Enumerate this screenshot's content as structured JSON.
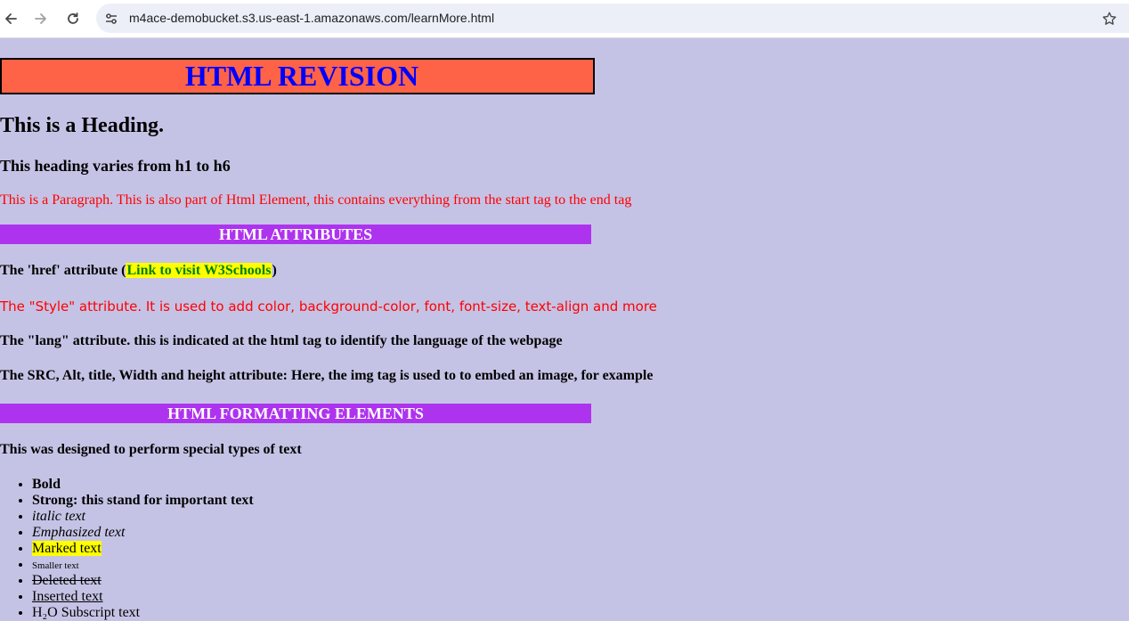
{
  "browser": {
    "url": "m4ace-demobucket.s3.us-east-1.amazonaws.com/learnMore.html",
    "icons": [
      "back-arrow-icon",
      "forward-arrow-icon",
      "reload-icon",
      "site-info-icon",
      "bookmark-star-icon"
    ]
  },
  "page": {
    "title": "HTML REVISION",
    "heading": "This is a Heading.",
    "subheading": "This heading varies from h1 to h6",
    "paragraph": "This is a Paragraph. This is also part of Html Element, this contains everything from the start tag to the end tag",
    "attributes_banner": "HTML ATTRIBUTES",
    "href": {
      "prefix": "The 'href' attribute (",
      "link": "Link to visit W3Schools",
      "suffix": ")"
    },
    "style_line": "The \"Style\" attribute. It is used to add color, background-color, font, font-size, text-align and more",
    "lang_line": "The \"lang\" attribute. this is indicated at the html tag to identify the language of the webpage",
    "src_line": "The SRC, Alt, title, Width and height attribute: Here, the img tag is used to to embed an image, for example",
    "formatting_banner": "HTML FORMATTING ELEMENTS",
    "formatting_intro": "This was designed to perform special types of text",
    "formatting_items": {
      "bold": "Bold",
      "strong": "Strong: this stand for important text",
      "italic": "italic text",
      "emphasized": "Emphasized text",
      "marked": "Marked text",
      "smaller": "Smaller text",
      "deleted": "Deleted text",
      "inserted": "Inserted text",
      "subscript_partial": "H₂O Subscript text"
    }
  },
  "colors": {
    "page_background": "#c5c3e5",
    "title_background": "#ff6347",
    "title_text": "#0000ff",
    "banner_background": "#ae33ee",
    "red_text": "#ff0000",
    "highlight": "#ffff00",
    "link_text": "#008000"
  }
}
